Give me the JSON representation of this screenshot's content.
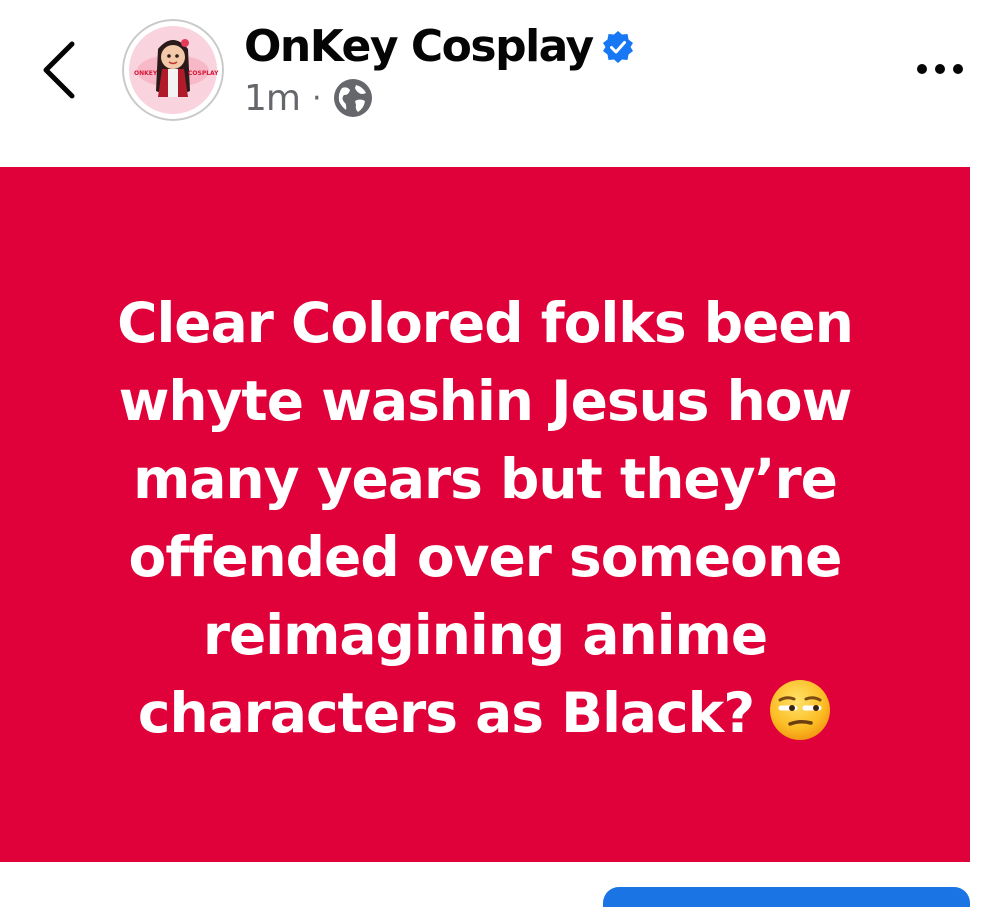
{
  "header": {
    "page_name": "OnKey Cosplay",
    "time": "1m",
    "separator": "·",
    "avatar_text_left": "ONKEY",
    "avatar_text_right": "COSPLAY",
    "icons": {
      "back": "back-chevron-icon",
      "verified": "verified-badge-icon",
      "audience": "globe-icon",
      "more": "more-options-icon"
    }
  },
  "post": {
    "background_color": "#e0003a",
    "text_color": "#ffffff",
    "lines": [
      "Clear Colored folks been",
      "whyte washin Jesus how",
      "many years but they’re",
      "offended over someone",
      "reimagining anime",
      "characters as Black?"
    ],
    "emoji": "unamused-face-emoji"
  },
  "colors": {
    "verified_blue": "#1877f2",
    "meta_gray": "#65676b",
    "button_blue": "#1b74e4"
  }
}
